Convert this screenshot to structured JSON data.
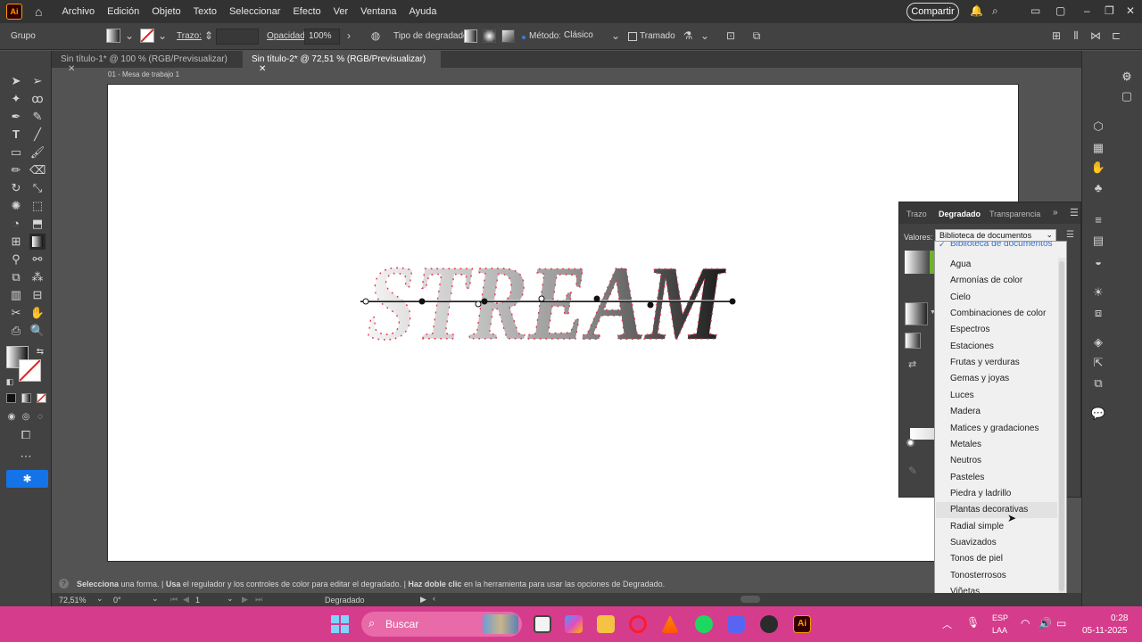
{
  "app": {
    "logo": "Ai"
  },
  "menu": [
    "Archivo",
    "Edición",
    "Objeto",
    "Texto",
    "Seleccionar",
    "Efecto",
    "Ver",
    "Ventana",
    "Ayuda"
  ],
  "share_label": "Compartir",
  "control_bar": {
    "selection_label": "Grupo",
    "stroke_label": "Trazo:",
    "opacity_label": "Opacidad:",
    "opacity_value": "100%",
    "gradient_type_label": "Tipo de degradado:",
    "method_label": "Método:",
    "method_value": "Clásico",
    "dither_label": "Tramado"
  },
  "tabs": [
    {
      "label": "Sin título-1* @ 100 % (RGB/Previsualizar)"
    },
    {
      "label": "Sin título-2* @ 72,51 % (RGB/Previsualizar)"
    }
  ],
  "artboard_label": "01 - Mesa de trabajo 1",
  "artwork_text": "STREAM",
  "panel": {
    "tabs": [
      "Trazo",
      "Degradado",
      "Transparencia"
    ],
    "values_label": "Valores:",
    "library_select": "Biblioteca de documentos"
  },
  "library_menu": {
    "header": "Biblioteca de documentos",
    "items": [
      "Agua",
      "Armonías de color",
      "Cielo",
      "Combinaciones de color",
      "Espectros",
      "Estaciones",
      "Frutas y verduras",
      "Gemas y joyas",
      "Luces",
      "Madera",
      "Matices y gradaciones",
      "Metales",
      "Neutros",
      "Pasteles",
      "Piedra y ladrillo",
      "Plantas decorativas",
      "Radial simple",
      "Suavizados",
      "Tonos de piel",
      "Tonosterrosos",
      "Viñetas"
    ],
    "hovered": "Plantas decorativas"
  },
  "hint": {
    "part1_bold": "Selecciona",
    "part1": " una forma. | ",
    "part2_bold": "Usa",
    "part2": " el regulador y los controles de color para editar el degradado. | ",
    "part3_bold": "Haz doble clic",
    "part3": " en la herramienta para usar las opciones de Degradado."
  },
  "status": {
    "zoom": "72,51%",
    "rotation": "0°",
    "artboard_num": "1",
    "tool": "Degradado"
  },
  "taskbar": {
    "search": "Buscar",
    "lang_top": "ESP",
    "lang_bottom": "LAA",
    "time": "0:28",
    "date": "05-11-2025"
  },
  "colors": {
    "accent_pink": "#d63c8c",
    "brand_orange": "#ff9a00",
    "anchor_red": "#e8334a"
  }
}
